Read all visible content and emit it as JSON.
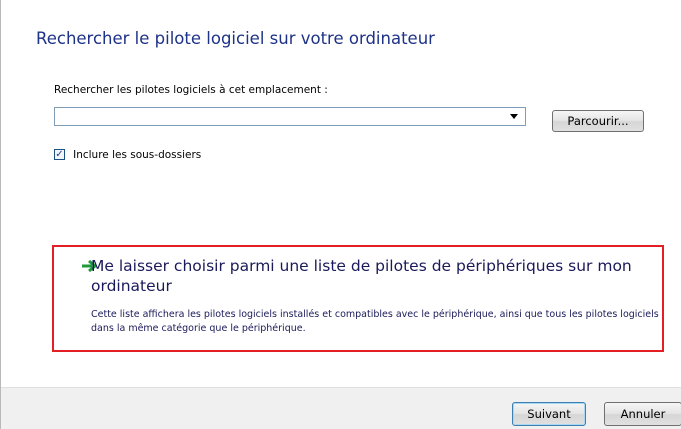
{
  "page": {
    "title": "Rechercher le pilote logiciel sur votre ordinateur",
    "search_label": "Rechercher les pilotes logiciels à cet emplacement :",
    "path_value": "",
    "browse_label": "Parcourir...",
    "include_subfolders": {
      "label": "Inclure les sous-dossiers",
      "checked": true,
      "check_glyph": "✓"
    }
  },
  "choose_option": {
    "title": "Me laisser choisir parmi une liste de pilotes de périphériques sur mon ordinateur",
    "description": "Cette liste affichera les pilotes logiciels installés et compatibles avec le périphérique, ainsi que tous les pilotes logiciels dans la même catégorie que le périphérique.",
    "icon": "green-arrow-icon"
  },
  "footer": {
    "next_label": "Suivant",
    "cancel_label": "Annuler"
  },
  "colors": {
    "title": "#1e3287",
    "highlight_border": "#e31e24",
    "arrow": "#1e9a3a"
  }
}
